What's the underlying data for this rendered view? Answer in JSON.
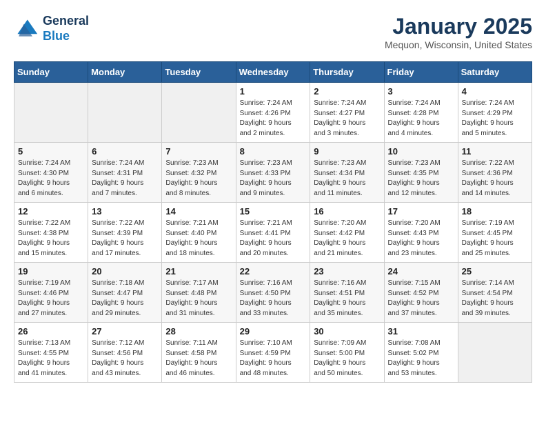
{
  "logo": {
    "line1": "General",
    "line2": "Blue"
  },
  "title": "January 2025",
  "location": "Mequon, Wisconsin, United States",
  "days_of_week": [
    "Sunday",
    "Monday",
    "Tuesday",
    "Wednesday",
    "Thursday",
    "Friday",
    "Saturday"
  ],
  "weeks": [
    [
      {
        "day": "",
        "sunrise": "",
        "sunset": "",
        "daylight": "",
        "empty": true
      },
      {
        "day": "",
        "sunrise": "",
        "sunset": "",
        "daylight": "",
        "empty": true
      },
      {
        "day": "",
        "sunrise": "",
        "sunset": "",
        "daylight": "",
        "empty": true
      },
      {
        "day": "1",
        "sunrise": "Sunrise: 7:24 AM",
        "sunset": "Sunset: 4:26 PM",
        "daylight": "Daylight: 9 hours and 2 minutes."
      },
      {
        "day": "2",
        "sunrise": "Sunrise: 7:24 AM",
        "sunset": "Sunset: 4:27 PM",
        "daylight": "Daylight: 9 hours and 3 minutes."
      },
      {
        "day": "3",
        "sunrise": "Sunrise: 7:24 AM",
        "sunset": "Sunset: 4:28 PM",
        "daylight": "Daylight: 9 hours and 4 minutes."
      },
      {
        "day": "4",
        "sunrise": "Sunrise: 7:24 AM",
        "sunset": "Sunset: 4:29 PM",
        "daylight": "Daylight: 9 hours and 5 minutes."
      }
    ],
    [
      {
        "day": "5",
        "sunrise": "Sunrise: 7:24 AM",
        "sunset": "Sunset: 4:30 PM",
        "daylight": "Daylight: 9 hours and 6 minutes."
      },
      {
        "day": "6",
        "sunrise": "Sunrise: 7:24 AM",
        "sunset": "Sunset: 4:31 PM",
        "daylight": "Daylight: 9 hours and 7 minutes."
      },
      {
        "day": "7",
        "sunrise": "Sunrise: 7:23 AM",
        "sunset": "Sunset: 4:32 PM",
        "daylight": "Daylight: 9 hours and 8 minutes."
      },
      {
        "day": "8",
        "sunrise": "Sunrise: 7:23 AM",
        "sunset": "Sunset: 4:33 PM",
        "daylight": "Daylight: 9 hours and 9 minutes."
      },
      {
        "day": "9",
        "sunrise": "Sunrise: 7:23 AM",
        "sunset": "Sunset: 4:34 PM",
        "daylight": "Daylight: 9 hours and 11 minutes."
      },
      {
        "day": "10",
        "sunrise": "Sunrise: 7:23 AM",
        "sunset": "Sunset: 4:35 PM",
        "daylight": "Daylight: 9 hours and 12 minutes."
      },
      {
        "day": "11",
        "sunrise": "Sunrise: 7:22 AM",
        "sunset": "Sunset: 4:36 PM",
        "daylight": "Daylight: 9 hours and 14 minutes."
      }
    ],
    [
      {
        "day": "12",
        "sunrise": "Sunrise: 7:22 AM",
        "sunset": "Sunset: 4:38 PM",
        "daylight": "Daylight: 9 hours and 15 minutes."
      },
      {
        "day": "13",
        "sunrise": "Sunrise: 7:22 AM",
        "sunset": "Sunset: 4:39 PM",
        "daylight": "Daylight: 9 hours and 17 minutes."
      },
      {
        "day": "14",
        "sunrise": "Sunrise: 7:21 AM",
        "sunset": "Sunset: 4:40 PM",
        "daylight": "Daylight: 9 hours and 18 minutes."
      },
      {
        "day": "15",
        "sunrise": "Sunrise: 7:21 AM",
        "sunset": "Sunset: 4:41 PM",
        "daylight": "Daylight: 9 hours and 20 minutes."
      },
      {
        "day": "16",
        "sunrise": "Sunrise: 7:20 AM",
        "sunset": "Sunset: 4:42 PM",
        "daylight": "Daylight: 9 hours and 21 minutes."
      },
      {
        "day": "17",
        "sunrise": "Sunrise: 7:20 AM",
        "sunset": "Sunset: 4:43 PM",
        "daylight": "Daylight: 9 hours and 23 minutes."
      },
      {
        "day": "18",
        "sunrise": "Sunrise: 7:19 AM",
        "sunset": "Sunset: 4:45 PM",
        "daylight": "Daylight: 9 hours and 25 minutes."
      }
    ],
    [
      {
        "day": "19",
        "sunrise": "Sunrise: 7:19 AM",
        "sunset": "Sunset: 4:46 PM",
        "daylight": "Daylight: 9 hours and 27 minutes."
      },
      {
        "day": "20",
        "sunrise": "Sunrise: 7:18 AM",
        "sunset": "Sunset: 4:47 PM",
        "daylight": "Daylight: 9 hours and 29 minutes."
      },
      {
        "day": "21",
        "sunrise": "Sunrise: 7:17 AM",
        "sunset": "Sunset: 4:48 PM",
        "daylight": "Daylight: 9 hours and 31 minutes."
      },
      {
        "day": "22",
        "sunrise": "Sunrise: 7:16 AM",
        "sunset": "Sunset: 4:50 PM",
        "daylight": "Daylight: 9 hours and 33 minutes."
      },
      {
        "day": "23",
        "sunrise": "Sunrise: 7:16 AM",
        "sunset": "Sunset: 4:51 PM",
        "daylight": "Daylight: 9 hours and 35 minutes."
      },
      {
        "day": "24",
        "sunrise": "Sunrise: 7:15 AM",
        "sunset": "Sunset: 4:52 PM",
        "daylight": "Daylight: 9 hours and 37 minutes."
      },
      {
        "day": "25",
        "sunrise": "Sunrise: 7:14 AM",
        "sunset": "Sunset: 4:54 PM",
        "daylight": "Daylight: 9 hours and 39 minutes."
      }
    ],
    [
      {
        "day": "26",
        "sunrise": "Sunrise: 7:13 AM",
        "sunset": "Sunset: 4:55 PM",
        "daylight": "Daylight: 9 hours and 41 minutes."
      },
      {
        "day": "27",
        "sunrise": "Sunrise: 7:12 AM",
        "sunset": "Sunset: 4:56 PM",
        "daylight": "Daylight: 9 hours and 43 minutes."
      },
      {
        "day": "28",
        "sunrise": "Sunrise: 7:11 AM",
        "sunset": "Sunset: 4:58 PM",
        "daylight": "Daylight: 9 hours and 46 minutes."
      },
      {
        "day": "29",
        "sunrise": "Sunrise: 7:10 AM",
        "sunset": "Sunset: 4:59 PM",
        "daylight": "Daylight: 9 hours and 48 minutes."
      },
      {
        "day": "30",
        "sunrise": "Sunrise: 7:09 AM",
        "sunset": "Sunset: 5:00 PM",
        "daylight": "Daylight: 9 hours and 50 minutes."
      },
      {
        "day": "31",
        "sunrise": "Sunrise: 7:08 AM",
        "sunset": "Sunset: 5:02 PM",
        "daylight": "Daylight: 9 hours and 53 minutes."
      },
      {
        "day": "",
        "sunrise": "",
        "sunset": "",
        "daylight": "",
        "empty": true
      }
    ]
  ]
}
